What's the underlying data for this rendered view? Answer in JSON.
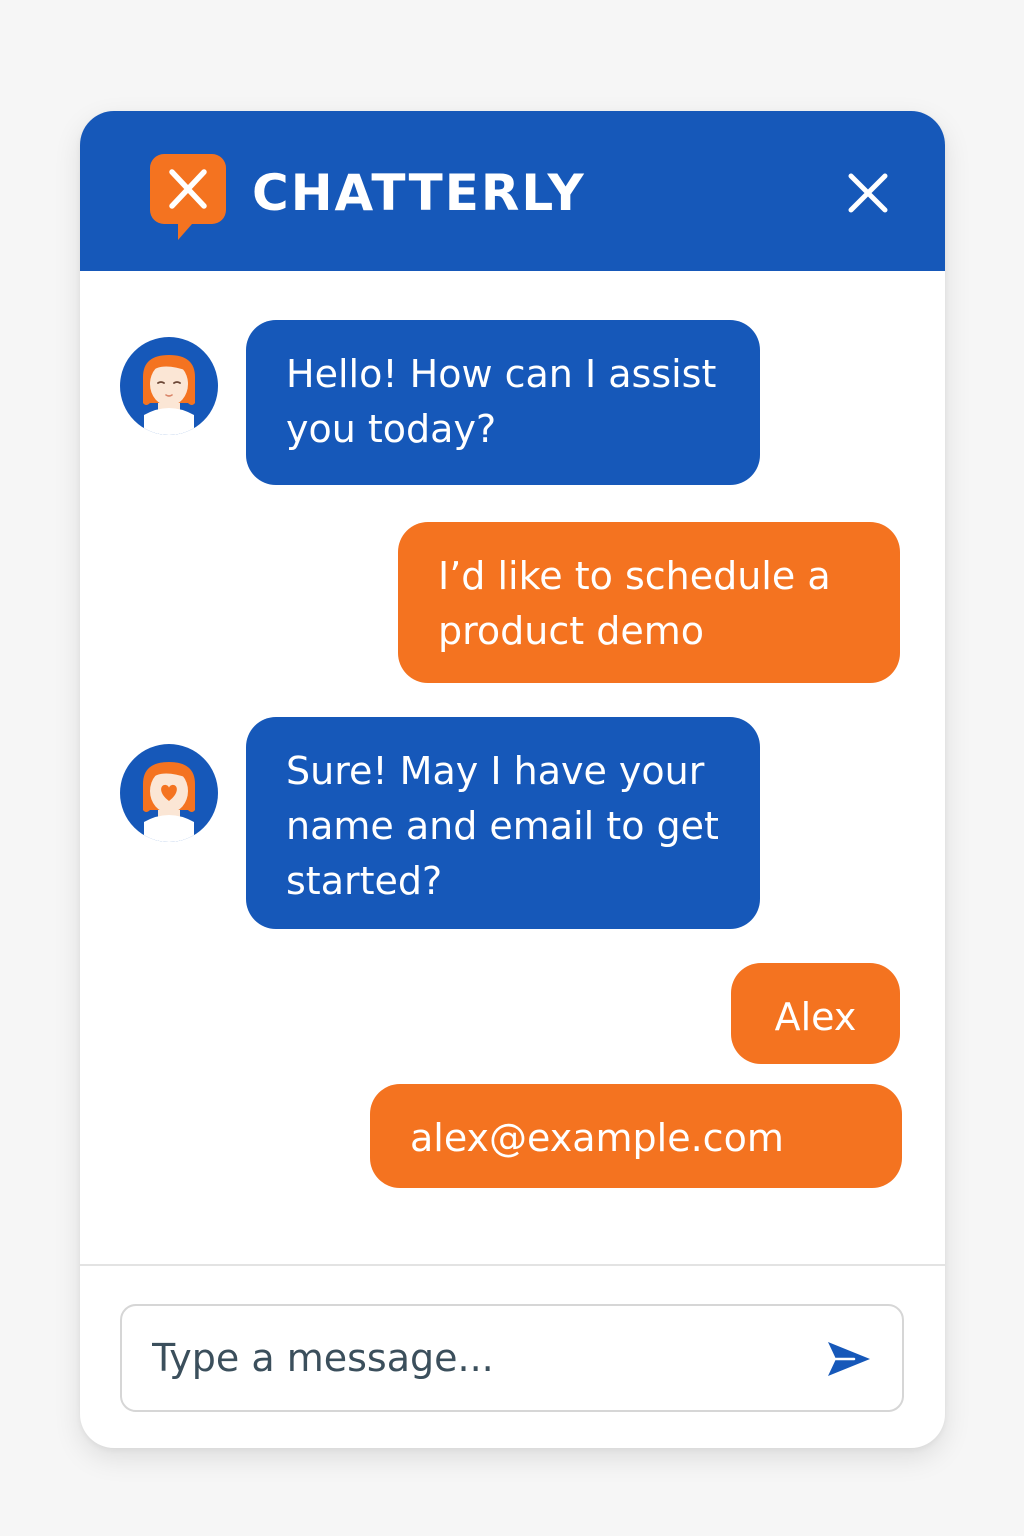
{
  "header": {
    "app_name": "CHATTERLY",
    "logo_icon": "chat-bubble-x-logo",
    "close_icon": "close-icon"
  },
  "messages": [
    {
      "sender": "bot",
      "text": "Hello! How can I assist you today?",
      "avatar": "agent-avatar"
    },
    {
      "sender": "user",
      "text": "I’d like to schedule a product demo"
    },
    {
      "sender": "bot",
      "text": "Sure! May I have your name and email to get started?",
      "avatar": "agent-avatar-heart"
    },
    {
      "sender": "user",
      "text": "Alex"
    },
    {
      "sender": "user",
      "text": "alex@example.com"
    }
  ],
  "composer": {
    "placeholder": "Type a message...",
    "value": "",
    "send_icon": "send-icon"
  },
  "colors": {
    "brand_blue": "#1658b9",
    "accent_orange": "#f47320",
    "page_background": "#f6f6f6"
  }
}
